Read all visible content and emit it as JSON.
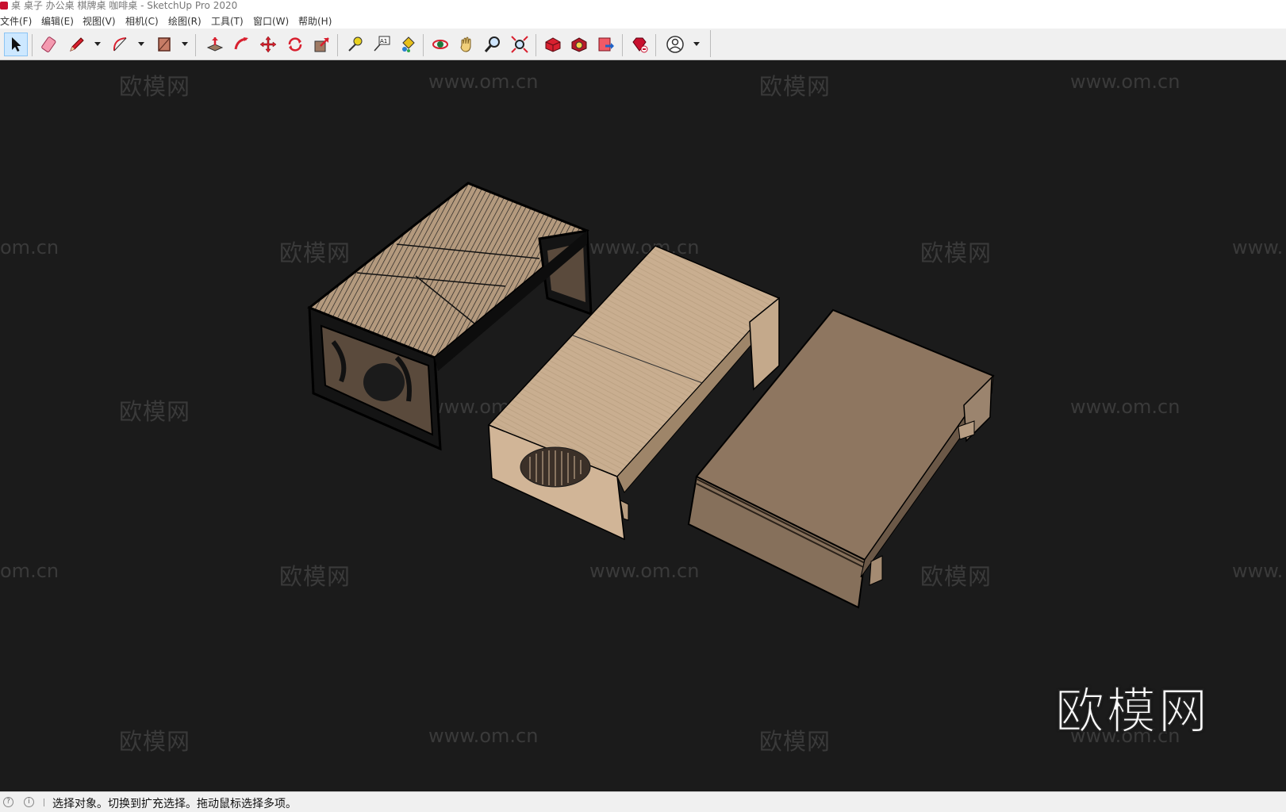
{
  "window": {
    "title": "桌 桌子 办公桌 棋牌桌 咖啡桌 - SketchUp Pro 2020"
  },
  "menu": [
    {
      "label": "文件(F)"
    },
    {
      "label": "编辑(E)"
    },
    {
      "label": "视图(V)"
    },
    {
      "label": "相机(C)"
    },
    {
      "label": "绘图(R)"
    },
    {
      "label": "工具(T)"
    },
    {
      "label": "窗口(W)"
    },
    {
      "label": "帮助(H)"
    }
  ],
  "toolbar": {
    "tools": [
      "select-icon",
      "eraser-icon",
      "pencil-line-icon",
      "arc-icon",
      "rectangle-icon",
      "push-pull-icon",
      "follow-me-icon",
      "move-icon",
      "rotate-icon",
      "scale-icon",
      "tape-measure-icon",
      "text-label-icon",
      "paint-bucket-icon",
      "orbit-icon",
      "pan-icon",
      "zoom-icon",
      "zoom-extents-icon",
      "3d-warehouse-icon",
      "extension-warehouse-icon",
      "layout-send-icon",
      "ruby-gem-icon",
      "account-icon"
    ],
    "active_tool": "select-icon",
    "text_tool_label": "A1"
  },
  "viewport": {
    "watermark_cn": "欧模网",
    "watermark_url": "www.om.cn",
    "watermark_url_partial_left": "om.cn",
    "watermark_url_partial_right": "www.",
    "brand_logo_text": "欧模网"
  },
  "colors": {
    "background": "#1b1b1b",
    "wood_light": "#c9ae90",
    "wood_dark": "#8f7760"
  },
  "status": {
    "hint": "选择对象。切换到扩充选择。拖动鼠标选择多项。"
  }
}
